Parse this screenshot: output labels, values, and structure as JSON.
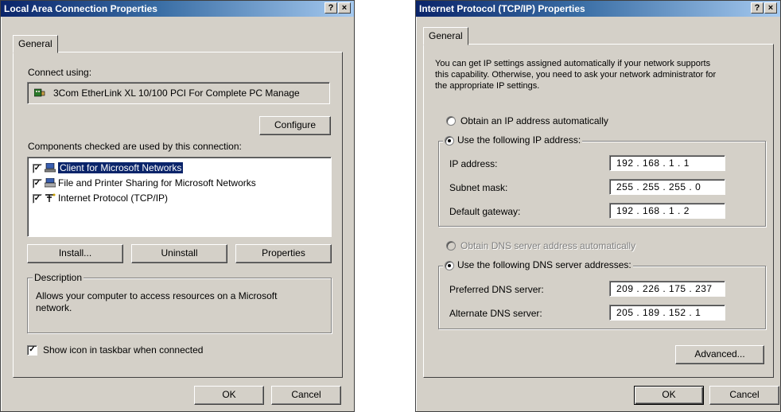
{
  "left_dialog": {
    "title": "Local Area Connection Properties",
    "help_btn": "?",
    "close_btn": "×",
    "tab": "General",
    "connect_using_label": "Connect using:",
    "adapter": "3Com EtherLink XL 10/100 PCI For Complete PC Manage",
    "configure_btn": "Configure",
    "components_label": "Components checked are used by this connection:",
    "components": [
      {
        "label": "Client for Microsoft Networks",
        "checked": true,
        "selected": true,
        "icon": "network-client-icon"
      },
      {
        "label": "File and Printer Sharing for Microsoft Networks",
        "checked": true,
        "selected": false,
        "icon": "file-printer-sharing-icon"
      },
      {
        "label": "Internet Protocol (TCP/IP)",
        "checked": true,
        "selected": false,
        "icon": "protocol-icon"
      }
    ],
    "install_btn": "Install...",
    "uninstall_btn": "Uninstall",
    "properties_btn": "Properties",
    "description_label": "Description",
    "description_text_1": "Allows your computer to access resources on a Microsoft",
    "description_text_2": "network.",
    "show_icon_label": "Show icon in taskbar when connected",
    "show_icon_checked": true,
    "ok_btn": "OK",
    "cancel_btn": "Cancel"
  },
  "right_dialog": {
    "title": "Internet Protocol (TCP/IP) Properties",
    "help_btn": "?",
    "close_btn": "×",
    "tab": "General",
    "intro_1": "You can get IP settings assigned automatically if your network supports",
    "intro_2": "this capability. Otherwise, you need to ask your network administrator for",
    "intro_3": "the appropriate IP settings.",
    "obtain_ip_label": "Obtain an IP address automatically",
    "use_ip_label": "Use the following IP address:",
    "ip_label": "IP address:",
    "ip_value": "192 . 168 .  1  .  1",
    "subnet_label": "Subnet mask:",
    "subnet_value": "255 . 255 . 255 .  0",
    "gateway_label": "Default gateway:",
    "gateway_value": "192 . 168 .  1  .  2",
    "obtain_dns_label": "Obtain DNS server address automatically",
    "use_dns_label": "Use the following DNS server addresses:",
    "preferred_dns_label": "Preferred DNS server:",
    "preferred_dns_value": "209 . 226 . 175 . 237",
    "alternate_dns_label": "Alternate DNS server:",
    "alternate_dns_value": "205 . 189 . 152 .  1",
    "advanced_btn": "Advanced...",
    "ok_btn": "OK",
    "cancel_btn": "Cancel"
  },
  "colors": {
    "dialog_face": "#d4d0c8",
    "title_start": "#0a246a",
    "title_end": "#a6caf0",
    "selection": "#0a246a"
  }
}
